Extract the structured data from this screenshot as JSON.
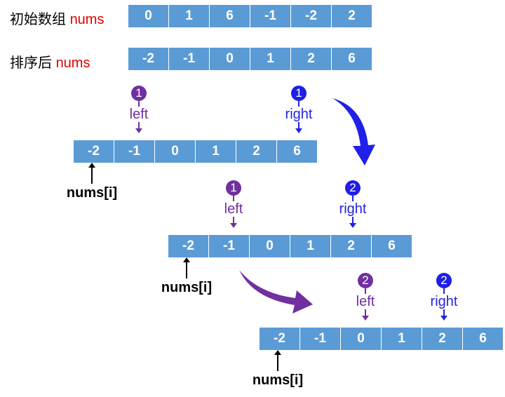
{
  "header": {
    "initial_label": "初始数组",
    "sorted_label": "排序后",
    "nums_word": "nums"
  },
  "initial_array": [
    "0",
    "1",
    "6",
    "-1",
    "-2",
    "2"
  ],
  "sorted_array": [
    "-2",
    "-1",
    "0",
    "1",
    "2",
    "6"
  ],
  "steps": [
    {
      "array": [
        "-2",
        "-1",
        "0",
        "1",
        "2",
        "6"
      ],
      "left": {
        "step": "1",
        "label": "left",
        "index": 1
      },
      "right": {
        "step": "1",
        "label": "right",
        "index": 5
      },
      "i_label": "nums[i]",
      "i_index": 0
    },
    {
      "array": [
        "-2",
        "-1",
        "0",
        "1",
        "2",
        "6"
      ],
      "left": {
        "step": "1",
        "label": "left",
        "index": 1
      },
      "right": {
        "step": "2",
        "label": "right",
        "index": 4
      },
      "i_label": "nums[i]",
      "i_index": 0
    },
    {
      "array": [
        "-2",
        "-1",
        "0",
        "1",
        "2",
        "6"
      ],
      "left": {
        "step": "2",
        "label": "left",
        "index": 2
      },
      "right": {
        "step": "2",
        "label": "right",
        "index": 4
      },
      "i_label": "nums[i]",
      "i_index": 0
    }
  ],
  "colors": {
    "cell": "#5b9bd5",
    "left": "#7030a0",
    "right": "#2222e0",
    "nums_word": "#e00000"
  }
}
